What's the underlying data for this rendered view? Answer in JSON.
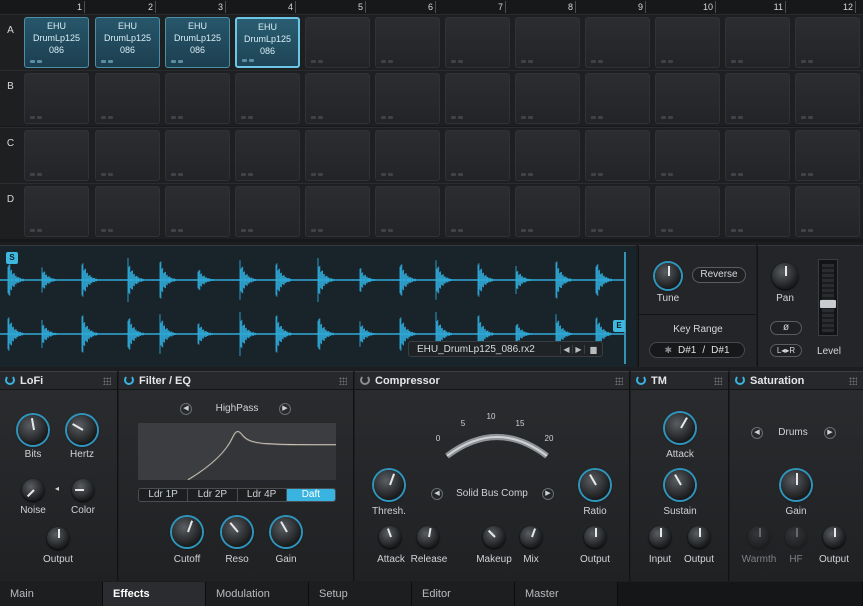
{
  "grid": {
    "columns": [
      "1",
      "2",
      "3",
      "4",
      "5",
      "6",
      "7",
      "8",
      "9",
      "10",
      "11",
      "12"
    ],
    "rows": [
      "A",
      "B",
      "C",
      "D"
    ],
    "loaded_pads": [
      {
        "label": "EHU\nDrumLp125\n086"
      },
      {
        "label": "EHU\nDrumLp125\n086"
      },
      {
        "label": "EHU\nDrumLp125\n086"
      },
      {
        "label": "EHU\nDrumLp125\n086"
      }
    ]
  },
  "sample": {
    "start_marker": "S",
    "end_marker": "E",
    "filename": "EHU_DrumLp125_086.rx2",
    "prev_icon": "chevron-left-icon",
    "next_icon": "chevron-right-icon",
    "folder_icon": "folder-icon"
  },
  "voice": {
    "tune_label": "Tune",
    "reverse_label": "Reverse",
    "key_range_label": "Key Range",
    "key_range_low": "D#1",
    "key_range_sep": "/",
    "key_range_high": "D#1",
    "pan_label": "Pan",
    "phase_symbol": "ø",
    "stereo_label": "L◂▸R",
    "level_label": "Level"
  },
  "effects": {
    "lofi": {
      "title": "LoFi",
      "bits": "Bits",
      "hertz": "Hertz",
      "noise": "Noise",
      "color": "Color",
      "output": "Output"
    },
    "filter": {
      "title": "Filter / EQ",
      "mode": "HighPass",
      "types": [
        "Ldr 1P",
        "Ldr 2P",
        "Ldr 4P",
        "Daft"
      ],
      "active_type": "Daft",
      "cutoff": "Cutoff",
      "reso": "Reso",
      "gain": "Gain"
    },
    "comp": {
      "title": "Compressor",
      "scale": [
        "0",
        "5",
        "10",
        "15",
        "20"
      ],
      "preset": "Solid Bus Comp",
      "thresh": "Thresh.",
      "ratio": "Ratio",
      "attack": "Attack",
      "release": "Release",
      "makeup": "Makeup",
      "mix": "Mix",
      "output": "Output"
    },
    "tm": {
      "title": "TM",
      "attack": "Attack",
      "sustain": "Sustain",
      "input": "Input",
      "output": "Output"
    },
    "saturation": {
      "title": "Saturation",
      "mode": "Drums",
      "gain": "Gain",
      "warmth": "Warmth",
      "hf": "HF",
      "output": "Output"
    }
  },
  "tabs": [
    "Main",
    "Effects",
    "Modulation",
    "Setup",
    "Editor",
    "Master"
  ],
  "active_tab": "Effects",
  "colors": {
    "accent": "#39b3e0",
    "waveform": "#2fa9d6",
    "pad_loaded": "#1f4a5c"
  }
}
